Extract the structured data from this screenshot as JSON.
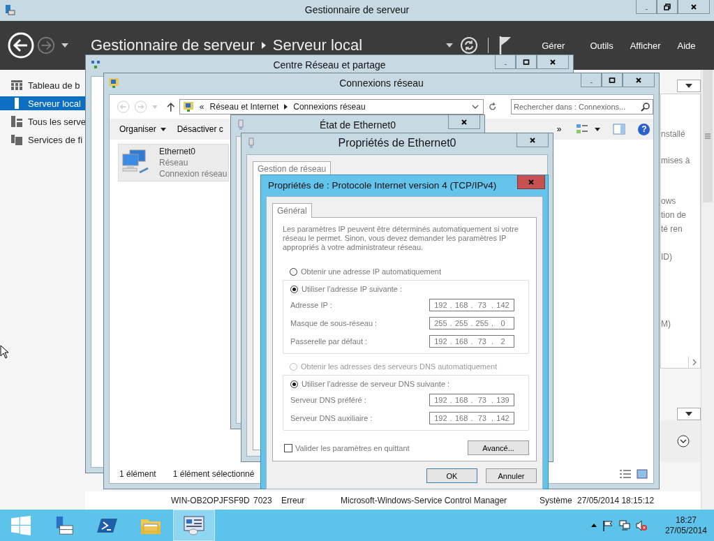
{
  "server_manager": {
    "title": "Gestionnaire de serveur",
    "breadcrumb": [
      "Gestionnaire de serveur",
      "Serveur local"
    ],
    "menu": [
      "Gérer",
      "Outils",
      "Afficher",
      "Aide"
    ],
    "sidebar": {
      "items": [
        {
          "label": "Tableau de b",
          "kind": "dashboard",
          "selected": false
        },
        {
          "label": "Serveur local",
          "kind": "server",
          "selected": true
        },
        {
          "label": "Tous les serve",
          "kind": "servers",
          "selected": false
        },
        {
          "label": "Services de fi",
          "kind": "files",
          "selected": false
        }
      ]
    },
    "fragments": [
      "nstallé",
      "mises à",
      "ows",
      "tion de",
      "té ren",
      "ID)",
      "M)"
    ],
    "event_row": [
      "WIN-OB2OPJFSF9D",
      "7023",
      "Erreur",
      "Microsoft-Windows-Service Control Manager",
      "Système",
      "27/05/2014 18:15:12"
    ]
  },
  "network_center": {
    "title": "Centre Réseau et partage"
  },
  "connections": {
    "title": "Connexions réseau",
    "address_prefix": "«",
    "address": [
      "Réseau et Internet",
      "Connexions réseau"
    ],
    "search": {
      "placeholder": "Rechercher dans : Connexions..."
    },
    "toolbar": [
      "Organiser",
      "Désactiver c"
    ],
    "overflow": "»",
    "item": {
      "name": "Ethernet0",
      "network": "Réseau",
      "detail": "Connexion réseau",
      "selected": true
    },
    "help": "?",
    "status": [
      "1 élément",
      "1 élément sélectionné"
    ]
  },
  "ethernet_status": {
    "title": "État de Ethernet0"
  },
  "ethernet_props": {
    "title": "Propriétés de Ethernet0",
    "tabs": [
      {
        "label": "Gestion de réseau",
        "selected": true
      }
    ]
  },
  "ipv4": {
    "title": "Propriétés de : Protocole Internet version 4 (TCP/IPv4)",
    "tabs": [
      {
        "label": "Général",
        "selected": true
      }
    ],
    "intro": "Les paramètres IP peuvent être déterminés automatiquement si votre réseau le permet. Sinon, vous devez demander les paramètres IP appropriés à votre administrateur réseau.",
    "groups": [
      {
        "auto": {
          "label": "Obtenir une adresse IP automatiquement",
          "selected": false,
          "disabled": false
        },
        "manual": {
          "label": "Utiliser l’adresse IP suivante :",
          "selected": true,
          "disabled": false
        },
        "fields": [
          {
            "label": "Adresse IP :",
            "octets": [
              "192",
              "168",
              "73",
              "142"
            ]
          },
          {
            "label": "Masque de sous-réseau :",
            "octets": [
              "255",
              "255",
              "255",
              "0"
            ]
          },
          {
            "label": "Passerelle par défaut :",
            "octets": [
              "192",
              "168",
              "73",
              "2"
            ]
          }
        ]
      },
      {
        "auto": {
          "label": "Obtenir les adresses des serveurs DNS automatiquement",
          "selected": false,
          "disabled": true
        },
        "manual": {
          "label": "Utiliser l’adresse de serveur DNS suivante :",
          "selected": true,
          "disabled": false
        },
        "fields": [
          {
            "label": "Serveur DNS préféré :",
            "octets": [
              "192",
              "168",
              "73",
              "139"
            ]
          },
          {
            "label": "Serveur DNS auxiliaire :",
            "octets": [
              "192",
              "168",
              "73",
              "142"
            ]
          }
        ]
      }
    ],
    "separator": ".",
    "validate": {
      "label": "Valider les paramètres en quittant",
      "checked": false
    },
    "advanced": "Avancé...",
    "buttons": [
      "OK",
      "Annuler"
    ]
  },
  "taskbar": {
    "apps": [
      {
        "kind": "start",
        "active": false
      },
      {
        "kind": "server-manager",
        "active": false
      },
      {
        "kind": "powershell",
        "active": false
      },
      {
        "kind": "explorer",
        "active": false
      },
      {
        "kind": "network",
        "active": true
      }
    ],
    "clock": {
      "time": "18:27",
      "date": "27/05/2014"
    }
  }
}
